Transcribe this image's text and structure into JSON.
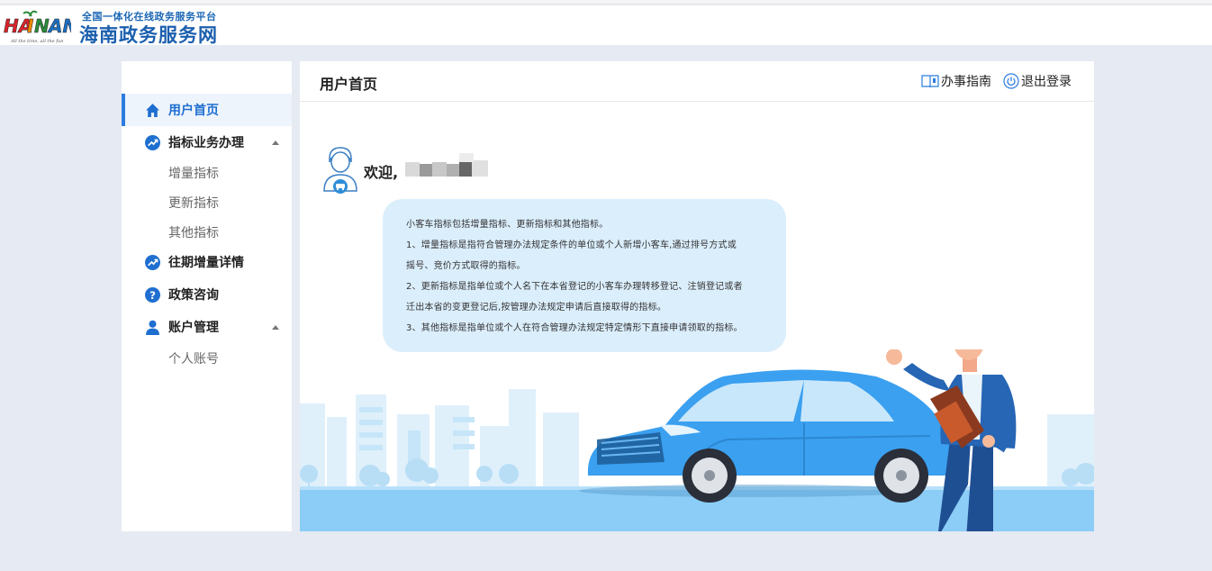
{
  "header": {
    "logo_text": "HAINAN",
    "logo_tagline": "All the time, all the fun",
    "subtitle": "全国一体化在线政务服务平台",
    "title": "海南政务服务网"
  },
  "sidebar": {
    "items": [
      {
        "label": "用户首页",
        "icon": "home-icon",
        "active": true
      },
      {
        "label": "指标业务办理",
        "icon": "trend-icon",
        "expanded": true,
        "children": [
          "增量指标",
          "更新指标",
          "其他指标"
        ]
      },
      {
        "label": "往期增量详情",
        "icon": "trend-icon"
      },
      {
        "label": "政策咨询",
        "icon": "question-icon"
      },
      {
        "label": "账户管理",
        "icon": "user-icon",
        "expanded": true,
        "children": [
          "个人账号"
        ]
      }
    ]
  },
  "main": {
    "title": "用户首页",
    "guide_label": "办事指南",
    "logout_label": "退出登录",
    "welcome": "欢迎,",
    "intro_lines": [
      "小客车指标包括增量指标、更新指标和其他指标。",
      "1、增量指标是指符合管理办法规定条件的单位或个人新增小客车,通过排号方式或",
      "摇号、竞价方式取得的指标。",
      "2、更新指标是指单位或个人名下在本省登记的小客车办理转移登记、注销登记或者",
      "迁出本省的变更登记后,按管理办法规定申请后直接取得的指标。",
      "3、其他指标是指单位或个人在符合管理办法规定特定情形下直接申请领取的指标。"
    ]
  },
  "colors": {
    "accent": "#2b7de0",
    "brand_blue": "#1b5fae",
    "bubble": "#dbeefc",
    "car": "#3b9ff0"
  }
}
